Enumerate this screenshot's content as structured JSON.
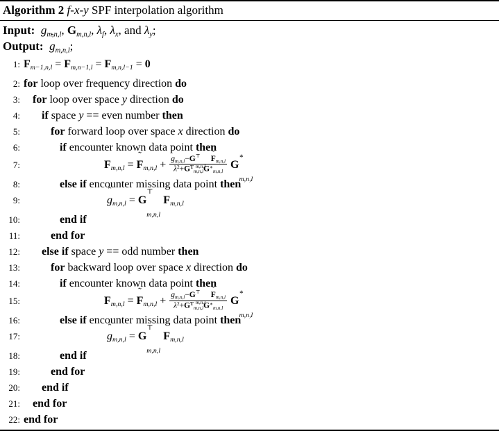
{
  "algorithm": {
    "header": {
      "keyword": "Algorithm",
      "number": "2",
      "title": "f-x-y SPF interpolation algorithm",
      "title_math": "f-x-y",
      "title_rest": "SPF interpolation algorithm"
    },
    "io": {
      "input_label": "Input:",
      "input_value": "g_{m,n,l}, G_{m,n,l}, λ_f, λ_x, and λ_y;",
      "output_label": "Output:",
      "output_value": "ĝ_{m,n,l};"
    },
    "lines": [
      {
        "no": "1:",
        "indent": 0,
        "text": "F_{m-1,n,l} = F_{m,n-1,l} = F_{m,n,l-1} = 0"
      },
      {
        "no": "2:",
        "indent": 0,
        "text": "for loop over frequency direction do"
      },
      {
        "no": "3:",
        "indent": 1,
        "text": "for loop over space y direction do"
      },
      {
        "no": "4:",
        "indent": 2,
        "text": "if space y == even number then"
      },
      {
        "no": "5:",
        "indent": 3,
        "text": "for forward loop over space x direction do"
      },
      {
        "no": "6:",
        "indent": 4,
        "text": "if encounter known data point then"
      },
      {
        "no": "7:",
        "indent": 5,
        "text": "F_{m,n,l} = F̃_{m,n,l} + (g_{m,n,l} - G^T_{m,n,l} F̃_{m,n,l}) / (λ^2 + G^T_{m,n,l} G*_{m,n,l}) G*_{m,n,l}"
      },
      {
        "no": "8:",
        "indent": 4,
        "text": "else if encounter missing data point then"
      },
      {
        "no": "9:",
        "indent": 5,
        "text": "ĝ_{m,n,l} = G^T_{m,n,l} F_{m,n,l}"
      },
      {
        "no": "10:",
        "indent": 4,
        "text": "end if"
      },
      {
        "no": "11:",
        "indent": 3,
        "text": "end for"
      },
      {
        "no": "12:",
        "indent": 2,
        "text": "else if space y == odd number then"
      },
      {
        "no": "13:",
        "indent": 3,
        "text": "for backward loop over space x direction do"
      },
      {
        "no": "14:",
        "indent": 4,
        "text": "if encounter known data point then"
      },
      {
        "no": "15:",
        "indent": 5,
        "text": "F_{m,n,l} = F̃_{m,n,l} + (g_{m,n,l} - G^T_{m,n,l} F̃_{m,n,l}) / (λ^2 + G^T_{m,n,l} G*_{m,n,l}) G*_{m,n,l}"
      },
      {
        "no": "16:",
        "indent": 4,
        "text": "else if encounter missing data point then"
      },
      {
        "no": "17:",
        "indent": 5,
        "text": "ĝ_{m,n,l} = G^T_{m,n,l} F_{m,n,l}"
      },
      {
        "no": "18:",
        "indent": 4,
        "text": "end if"
      },
      {
        "no": "19:",
        "indent": 3,
        "text": "end for"
      },
      {
        "no": "20:",
        "indent": 2,
        "text": "end if"
      },
      {
        "no": "21:",
        "indent": 1,
        "text": "end for"
      },
      {
        "no": "22:",
        "indent": 0,
        "text": "end for"
      }
    ],
    "keywords": {
      "for": "for",
      "do": "do",
      "if": "if",
      "then": "then",
      "else_if": "else if",
      "end_if": "end if",
      "end_for": "end for"
    },
    "words": {
      "loop_over_frequency_direction": "loop over frequency direction",
      "loop_over_space": "loop over space",
      "direction": "direction",
      "space": "space",
      "eq_eq": "==",
      "even_number": "even number",
      "odd_number": "odd number",
      "forward_loop_over_space": "forward loop over space",
      "backward_loop_over_space": "backward loop over space",
      "encounter_known_data_point": "encounter known data point",
      "encounter_missing_data_point": "encounter missing data point",
      "and": "and",
      "var_x": "x",
      "var_y": "y",
      "var_f": "f",
      "var_m": "m",
      "var_n": "n",
      "var_l": "l",
      "sym_lambda": "λ",
      "sym_g": "g",
      "sym_G": "G",
      "sym_F": "F",
      "sym_T": "⊤",
      "sym_star": "∗",
      "sym_zero": "0",
      "sym_eq": "=",
      "sym_plus": "+",
      "sym_minus": "−",
      "sym_two": "2",
      "sym_one": "1",
      "sym_comma": ",",
      "sym_semicolon": ";",
      "sym_tilde": "˜",
      "sym_hat": "ˆ"
    },
    "colors": {
      "text": "#000000",
      "background": "#ffffff",
      "rule": "#000000"
    }
  }
}
